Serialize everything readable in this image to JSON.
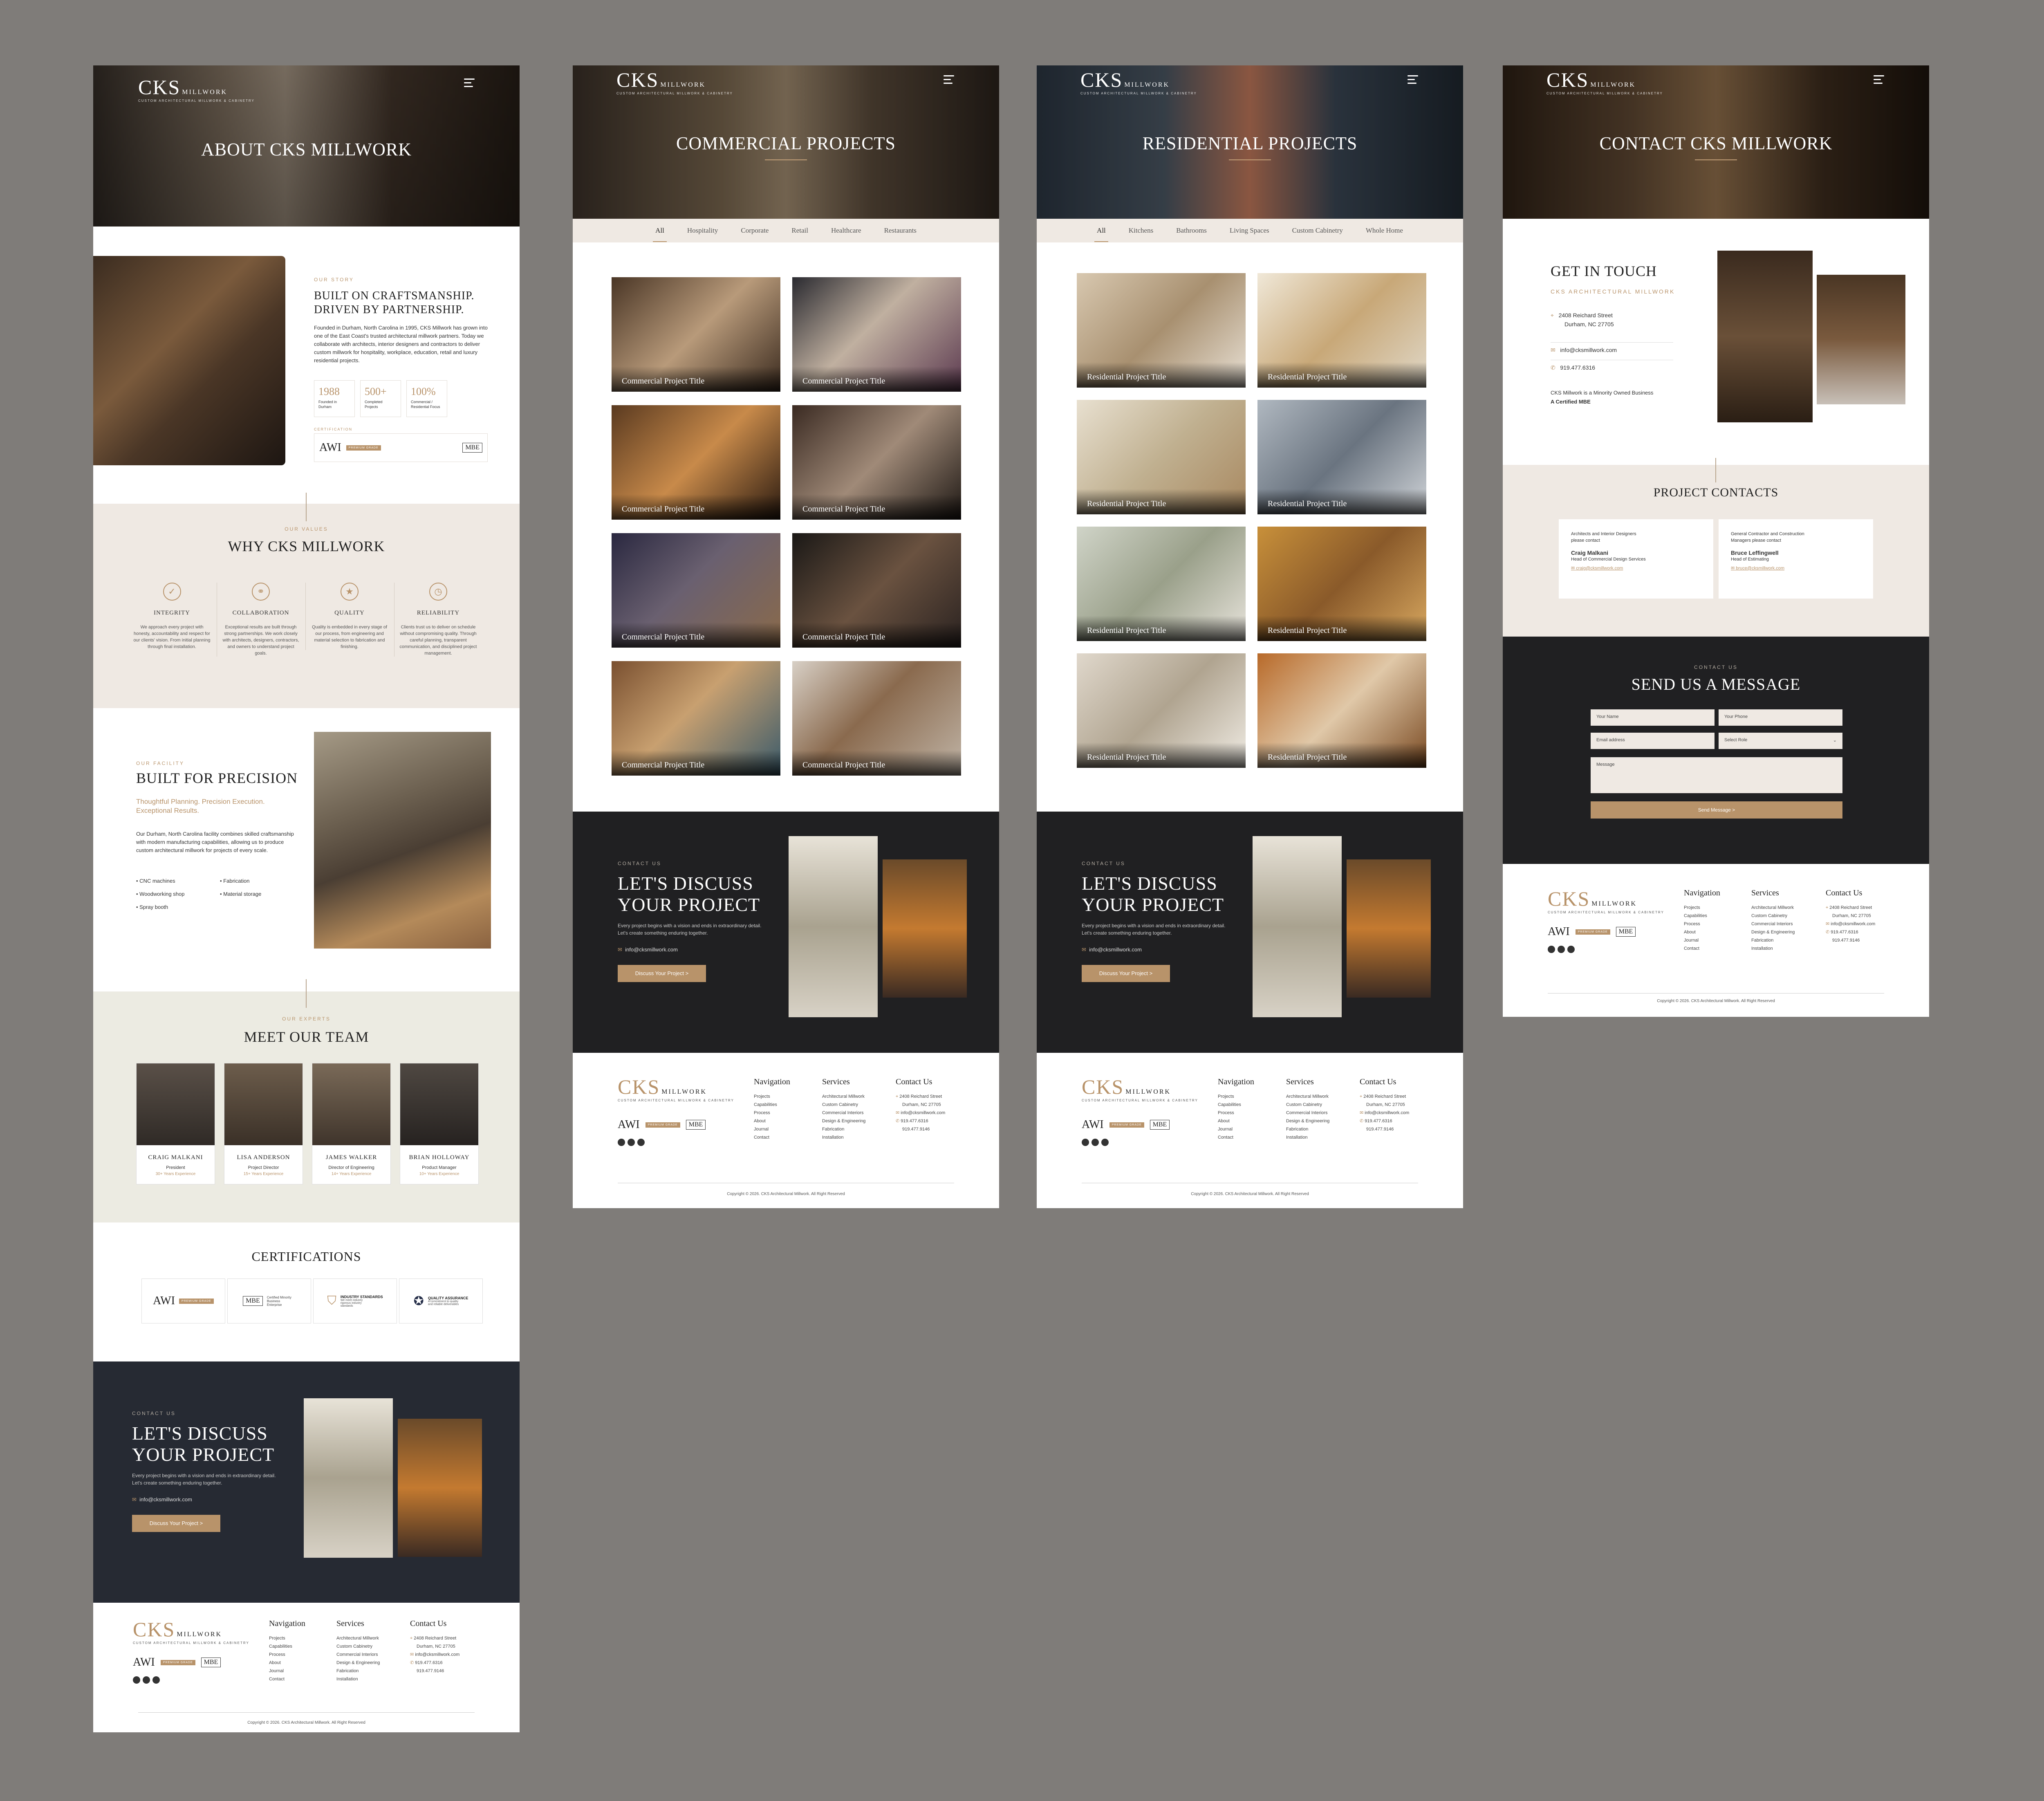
{
  "brand": {
    "logo": "CKS",
    "logo_sub": "MILLWORK",
    "tagline": "CUSTOM ARCHITECTURAL MILLWORK & CABINETRY",
    "accent": "#b8936a",
    "dark": "#202022"
  },
  "about": {
    "hero_title": "ABOUT CKS MILLWORK",
    "story_label": "OUR STORY",
    "story_title_1": "BUILT ON CRAFTSMANSHIP.",
    "story_title_2": "DRIVEN BY PARTNERSHIP.",
    "story_body": "Founded in Durham, North Carolina in 1995, CKS Millwork has grown into one of the East Coast's trusted architectural millwork partners. Today we collaborate with architects, interior designers and contractors to deliver custom millwork for hospitality, workplace, education, retail and luxury residential projects.",
    "stats": [
      {
        "n": "1988",
        "l": "Founded in Durham"
      },
      {
        "n": "500+",
        "l": "Completed Projects"
      },
      {
        "n": "100%",
        "l": "Commercial / Residential Focus"
      }
    ],
    "cert_label": "CERTIFICATION",
    "values_label": "OUR VALUES",
    "values_title": "WHY CKS MILLWORK",
    "values": [
      {
        "icon": "shield-icon",
        "glyph": "✓",
        "t": "INTEGRITY",
        "d": "We approach every project with honesty, accountability and respect for our clients' vision. From initial planning through final installation."
      },
      {
        "icon": "handshake-icon",
        "glyph": "⚭",
        "t": "COLLABORATION",
        "d": "Exceptional results are built through strong partnerships. We work closely with architects, designers, contractors, and owners to understand project goals."
      },
      {
        "icon": "medal-icon",
        "glyph": "★",
        "t": "QUALITY",
        "d": "Quality is embedded in every stage of our process, from engineering and material selection to fabrication and finishing."
      },
      {
        "icon": "clock-icon",
        "glyph": "◷",
        "t": "RELIABILITY",
        "d": "Clients trust us to deliver on schedule without compromising quality. Through careful planning, transparent communication, and disciplined project management."
      }
    ],
    "facility_label": "OUR FACILITY",
    "facility_title": "BUILT FOR PRECISION",
    "facility_sub_1": "Thoughtful Planning. Precision Execution.",
    "facility_sub_2": "Exceptional Results.",
    "facility_body": "Our Durham, North Carolina facility combines skilled craftsmanship with modern manufacturing capabilities, allowing us to produce custom architectural millwork for projects of every scale.",
    "facility_list": [
      "CNC machines",
      "Fabrication",
      "Woodworking shop",
      "Material storage",
      "Spray booth"
    ],
    "team_label": "OUR EXPERTS",
    "team_title": "MEET OUR TEAM",
    "team": [
      {
        "n": "CRAIG MALKANI",
        "r": "President",
        "e": "30+ Years Experience"
      },
      {
        "n": "LISA ANDERSON",
        "r": "Project Director",
        "e": "15+ Years Experience"
      },
      {
        "n": "JAMES WALKER",
        "r": "Director of Engineering",
        "e": "14+ Years Experience"
      },
      {
        "n": "BRIAN HOLLOWAY",
        "r": "Product Manager",
        "e": "10+ Years Experience"
      }
    ],
    "certs_title": "CERTIFICATIONS",
    "certs": [
      {
        "a": "AWI",
        "b": "PREMIUM GRADE"
      },
      {
        "a": "MBE",
        "b": "Certified Minority Business Enterprise"
      },
      {
        "a": "INDUSTRY STANDARDS",
        "b": "We meet industry rigorous industry standards"
      },
      {
        "a": "QUALITY ASSURANCE",
        "b": "A commitment to quality and reliable deliverables"
      }
    ]
  },
  "discuss": {
    "label": "CONTACT US",
    "title_1": "LET'S DISCUSS",
    "title_2": "YOUR PROJECT",
    "desc": "Every project begins with a vision and ends in extraordinary detail. Let's create something enduring together.",
    "email": "info@cksmillwork.com",
    "button": "Discuss Your Project  >"
  },
  "footer": {
    "awi": "AWI",
    "awi_badge": "PREMIUM GRADE",
    "mbe": "MBE",
    "nav_title": "Navigation",
    "nav": [
      "Projects",
      "Capabilities",
      "Process",
      "About",
      "Journal",
      "Contact"
    ],
    "services_title": "Services",
    "services": [
      "Architectural Millwork",
      "Custom Cabinetry",
      "Commercial Interiors",
      "Design & Engineering",
      "Fabrication",
      "Installation"
    ],
    "contact_title": "Contact Us",
    "address_1": "2408 Reichard Street",
    "address_2": "Durham, NC 27705",
    "email": "info@cksmillwork.com",
    "phone_1": "919.477.6316",
    "phone_2": "919.477.9146",
    "copyright": "Copyright © 2026. CKS Architectural Millwork. All Right Reserved"
  },
  "commercial": {
    "hero_title": "COMMERCIAL PROJECTS",
    "tabs": [
      "All",
      "Hospitality",
      "Corporate",
      "Retail",
      "Healthcare",
      "Restaurants"
    ],
    "card_title": "Commercial Project Title"
  },
  "residential": {
    "hero_title": "RESIDENTIAL PROJECTS",
    "tabs": [
      "All",
      "Kitchens",
      "Bathrooms",
      "Living Spaces",
      "Custom Cabinetry",
      "Whole Home"
    ],
    "card_title": "Residential Project Title"
  },
  "contact": {
    "hero_title": "CONTACT CKS MILLWORK",
    "gt_title": "GET IN TOUCH",
    "gt_sub": "CKS ARCHITECTURAL MILLWORK",
    "address_1": "2408 Reichard Street",
    "address_2": "Durham, NC 27705",
    "email": "info@cksmillwork.com",
    "phone": "919.477.6316",
    "mbe_1": "CKS Millwork is a Minority Owned Business",
    "mbe_2": "A Certified MBE",
    "pc_title": "PROJECT CONTACTS",
    "contacts": [
      {
        "intro_1": "Architects and Interior Designers",
        "intro_2": "please contact",
        "n": "Craig Malkani",
        "r": "Head of Commercial Design Services",
        "e": "craig@cksmillwork.com"
      },
      {
        "intro_1": "General Contractor and Construction",
        "intro_2": "Managers please contact",
        "n": "Bruce Leffingwell",
        "r": "Head of Estimating",
        "e": "bruce@cksmillwork.com"
      }
    ],
    "form_label": "CONTACT US",
    "form_title": "SEND US A MESSAGE",
    "ph_name": "Your Name",
    "ph_phone": "Your Phone",
    "ph_email": "Email address",
    "ph_role": "Select Role",
    "ph_message": "Message",
    "send": "Send Message  >"
  }
}
